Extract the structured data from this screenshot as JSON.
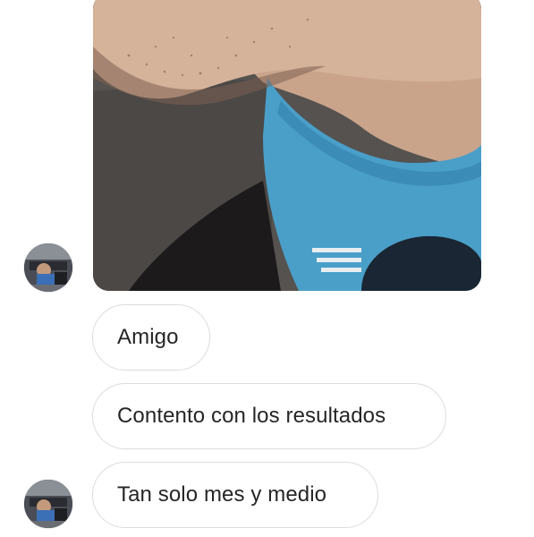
{
  "conversation": {
    "photo_message": {
      "icon": "photo-message"
    },
    "messages": [
      {
        "text": "Amigo"
      },
      {
        "text": "Contento con los resultados"
      },
      {
        "text": "Tan solo mes y medio"
      }
    ]
  },
  "colors": {
    "bubble_border": "#dcdcdc",
    "bubble_text": "#262626",
    "background": "#ffffff"
  }
}
